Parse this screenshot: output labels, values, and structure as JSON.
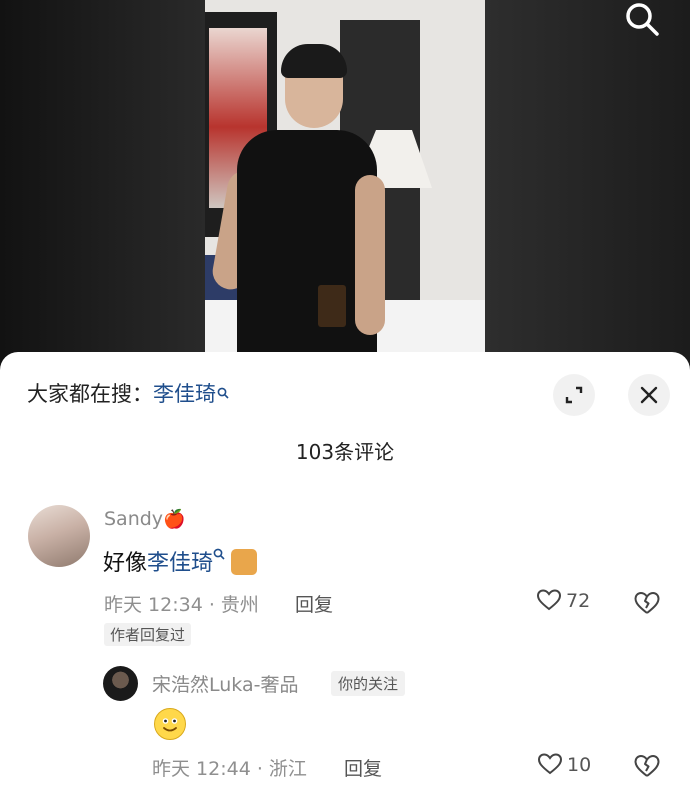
{
  "hot_search": {
    "prefix": "大家都在搜：",
    "keyword": "李佳琦"
  },
  "comment_count": "103条评论",
  "comments": [
    {
      "username": "Sandy",
      "username_emoji": "🍎",
      "text_prefix": "好像",
      "text_keyword": "李佳琦",
      "time_location": "昨天 12:34 · 贵州",
      "reply_label": "回复",
      "likes": "72",
      "author_replied_tag": "作者回复过"
    },
    {
      "username": "宋浩然Luka-奢品",
      "follow_badge": "你的关注",
      "text_emoji": "smiling-emoji",
      "time_location": "昨天 12:44 · 浙江",
      "reply_label": "回复",
      "likes": "10"
    }
  ],
  "icons": [
    "search-icon",
    "expand-icon",
    "close-icon",
    "heart-icon",
    "broken-heart-icon"
  ],
  "colors": {
    "keyword": "#1f4e8c",
    "muted": "#8f8f8f"
  }
}
